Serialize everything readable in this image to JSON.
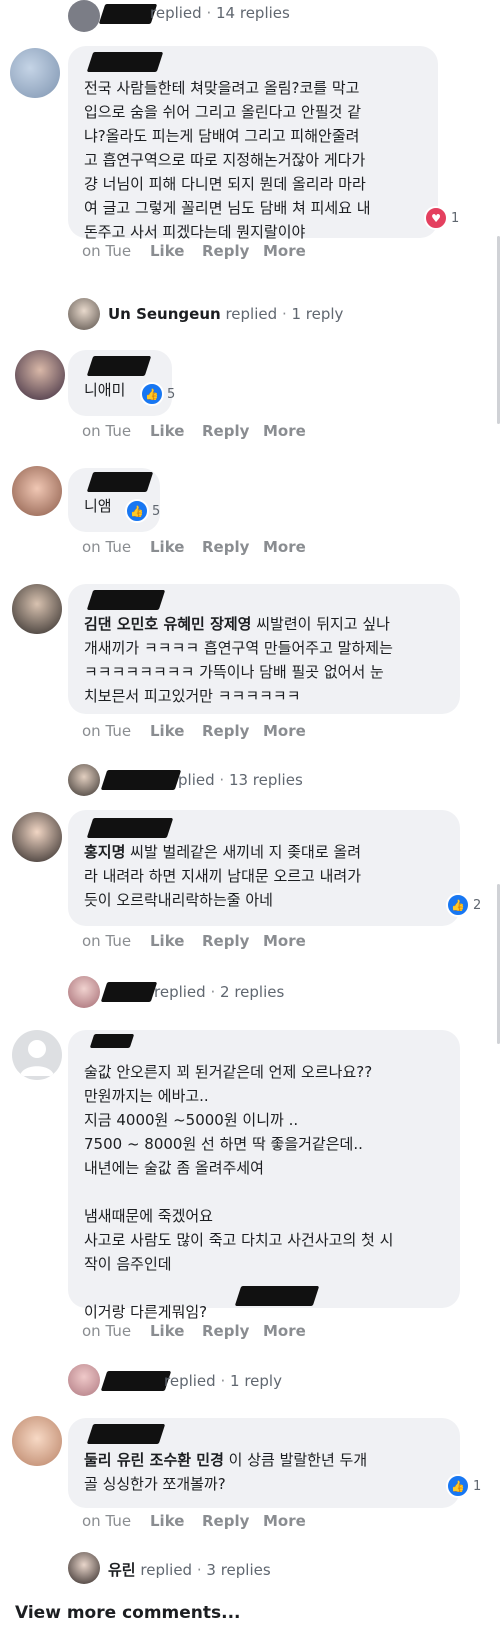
{
  "actions": {
    "time": "on Tue",
    "like": "Like",
    "reply": "Reply",
    "more": "More"
  },
  "top_reply": {
    "label": "replied",
    "count": "14 replies"
  },
  "comments": [
    {
      "lines": [
        "전국 사람들한테 쳐맞을려고 올림?코를 막고",
        "입으로 숨을 쉬어 그리고 올린다고 안필것 같",
        "냐?올라도 피는게 담배여 그리고 피해안줄려",
        "고 흡연구역으로 따로 지정해논거잖아 게다가",
        "걍 너님이 피해 다니면 되지 뭔데 올리라 마라",
        "여 글고 그렇게 꼴리면 님도 담배 쳐 피세요 내",
        "돈주고 사서 피겠다는데 뭔지랄이야"
      ],
      "reaction_count": "1",
      "reply": {
        "name": "Un Seungeun",
        "label": "replied",
        "count": "1 reply"
      }
    },
    {
      "lines": [
        "니애미"
      ],
      "reaction_count": "5"
    },
    {
      "lines": [
        "니앰"
      ],
      "reaction_count": "5"
    },
    {
      "names": "김댄 오민호 유혜민 장제영",
      "lines": [
        " 씨발련이 뒤지고 싶나",
        "개새끼가 ㅋㅋㅋㅋ 흡연구역 만들어주고 말하제는",
        "ㅋㅋㅋㅋㅋㅋㅋㅋ 가뜩이나 담배 필곳 없어서 눈",
        "치보믄서 피고있거만 ㅋㅋㅋㅋㅋㅋ"
      ],
      "reply": {
        "label": "plied",
        "count": "13 replies"
      }
    },
    {
      "names": "홍지명",
      "lines": [
        " 씨발 벌레같은 새끼네 지 좆대로 올려",
        "라 내려라 하면 지새끼 남대문 오르고 내려가",
        "듯이 오르락내리락하는줄 아네"
      ],
      "reaction_count": "2",
      "reply": {
        "label": "replied",
        "count": "2 replies"
      }
    },
    {
      "lines": [
        "술값 안오른지 꾀 된거같은데 언제 오르나요??",
        "만원까지는 에바고..",
        "지금 4000원 ~5000원 이니까 ..",
        "7500 ~ 8000원 선 하면 딱 좋을거같은데..",
        "내년에는 술값 좀 올려주세여",
        "",
        "냄새때문에 죽겠어요",
        "사고로 사람도 많이 죽고 다치고 사건사고의 첫 시",
        "작이 음주인데",
        "",
        "이거랑 다른게뭐임?"
      ],
      "reply": {
        "label": "replied",
        "count": "1 reply"
      }
    },
    {
      "names": "둘리 유린 조수환 민경",
      "lines": [
        " 이 상큼 발랄한년 두개",
        "골 싱싱한가 쪼개볼까?"
      ],
      "reaction_count": "1",
      "reply": {
        "name": "유린",
        "label": "replied",
        "count": "3 replies"
      }
    }
  ],
  "view_more": "View more comments...",
  "colors": {
    "bubble": "#f0f1f4",
    "like": "#1877f2",
    "love": "#e4405f",
    "muted": "#8a8d91"
  }
}
